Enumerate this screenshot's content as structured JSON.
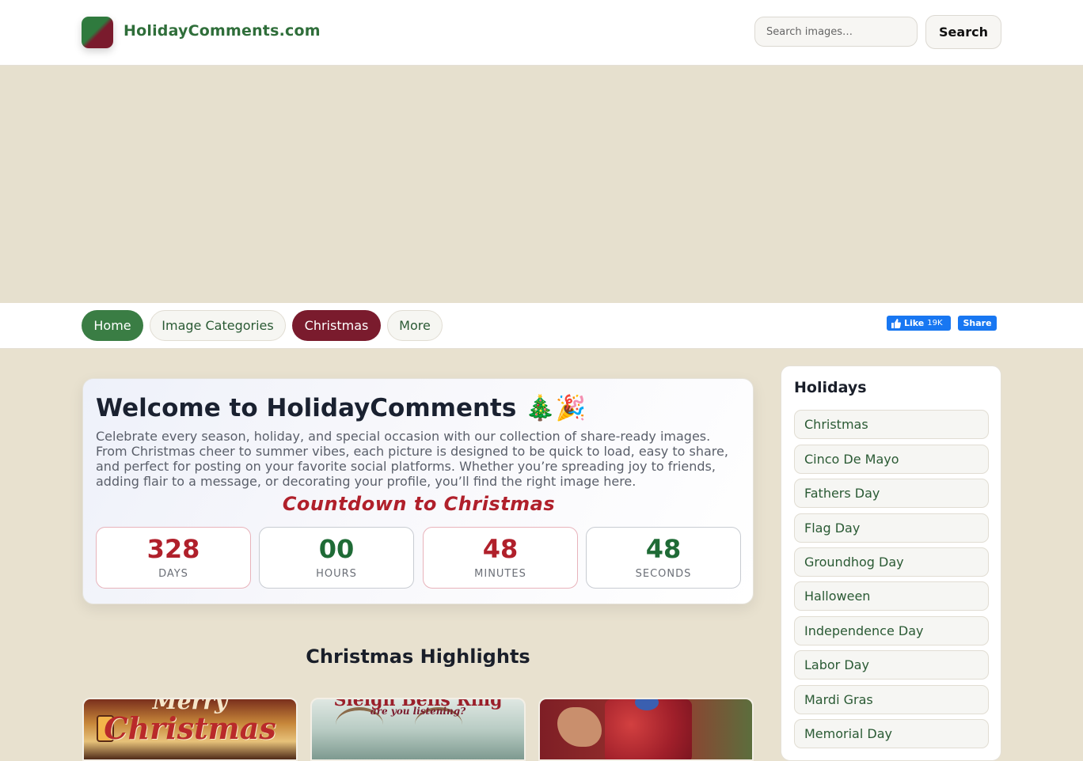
{
  "header": {
    "site_name": "HolidayComments.com",
    "search_placeholder": "Search images…",
    "search_button": "Search"
  },
  "nav": {
    "items": [
      "Home",
      "Image Categories",
      "Christmas",
      "More"
    ],
    "facebook": {
      "like_label": "Like",
      "like_count": "19K",
      "share_label": "Share"
    }
  },
  "welcome": {
    "title": "Welcome to HolidayComments 🎄🎉",
    "text": "Celebrate every season, holiday, and special occasion with our collection of share-ready images. From Christmas cheer to summer vibes, each picture is designed to be quick to load, easy to share, and perfect for posting on your favorite social platforms. Whether you’re spreading joy to friends, adding flair to a message, or decorating your profile, you’ll find the right image here.",
    "countdown_title": "Countdown to Christmas",
    "countdown": [
      {
        "value": "328",
        "label": "DAYS"
      },
      {
        "value": "00",
        "label": "HOURS"
      },
      {
        "value": "48",
        "label": "MINUTES"
      },
      {
        "value": "48",
        "label": "SECONDS"
      }
    ]
  },
  "highlights": {
    "title": "Christmas Highlights",
    "thumbs": [
      {
        "line1": "Merry",
        "line2": "Christmas"
      },
      {
        "line1": "Sleigh Bells Ring",
        "line2": "are you listening?"
      },
      {
        "line1": "",
        "line2": ""
      }
    ]
  },
  "sidebar": {
    "title": "Holidays",
    "items": [
      "Christmas",
      "Cinco De Mayo",
      "Fathers Day",
      "Flag Day",
      "Groundhog Day",
      "Halloween",
      "Independence Day",
      "Labor Day",
      "Mardi Gras",
      "Memorial Day"
    ]
  },
  "colors": {
    "brand_green": "#3a7d44",
    "brand_red": "#7a1b2d",
    "countdown_red": "#b0202b",
    "countdown_green": "#1f6b36",
    "facebook_blue": "#1877f2",
    "page_background": "#e8e1cf"
  }
}
